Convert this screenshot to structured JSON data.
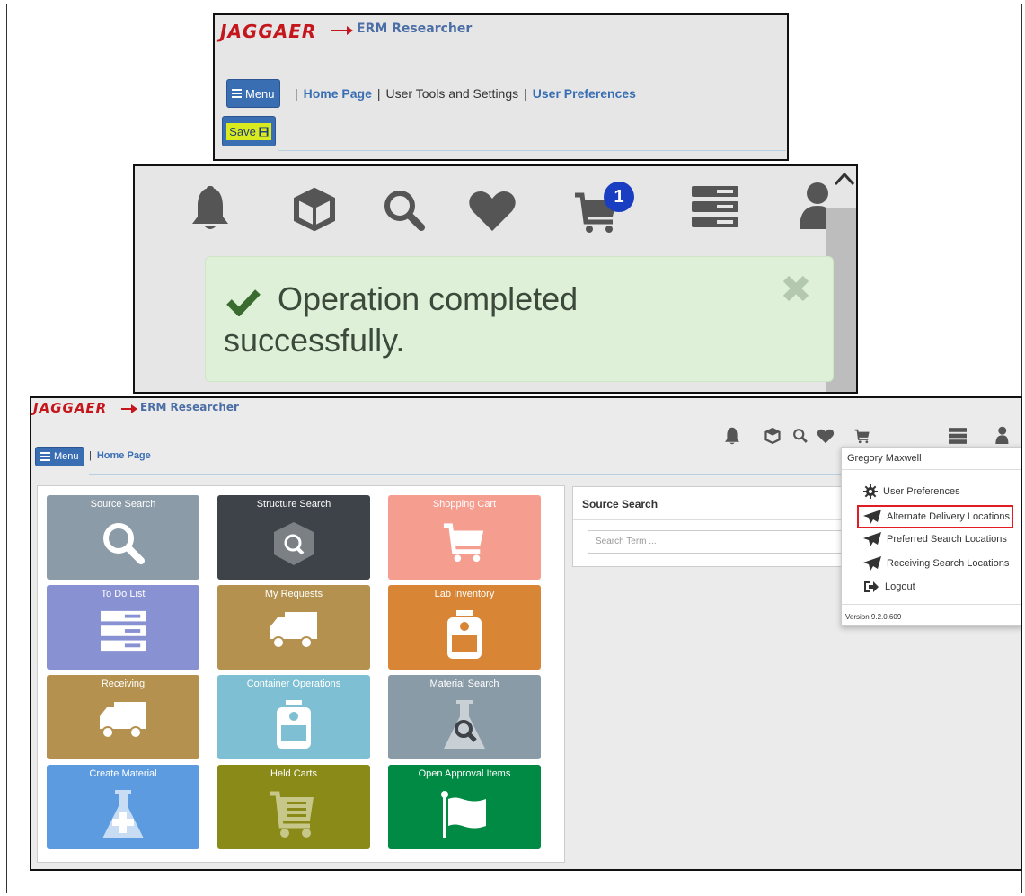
{
  "panel1": {
    "logo": "JAGGAER",
    "app_name": "ERM Researcher",
    "menu_label": "Menu",
    "breadcrumb": [
      "Home Page",
      "User Tools and Settings",
      "User Preferences"
    ],
    "save_label": "Save"
  },
  "panel2": {
    "cart_count": "1",
    "message_line1": "Operation completed",
    "message_line2": "successfully."
  },
  "panel3": {
    "logo": "JAGGAER",
    "app_name": "ERM Researcher",
    "menu_label": "Menu",
    "breadcrumb": "Home Page",
    "tiles": [
      {
        "label": "Source Search",
        "color": "#8c9ba8",
        "icon": "search-icon"
      },
      {
        "label": "Structure Search",
        "color": "#3d4349",
        "icon": "cube-search-icon"
      },
      {
        "label": "Shopping Cart",
        "color": "#f59d8f",
        "icon": "cart-icon"
      },
      {
        "label": "To Do List",
        "color": "#8891d2",
        "icon": "server-icon"
      },
      {
        "label": "My Requests",
        "color": "#b4914f",
        "icon": "truck-icon"
      },
      {
        "label": "Lab Inventory",
        "color": "#d88535",
        "icon": "bottle-icon"
      },
      {
        "label": "Receiving",
        "color": "#b4914f",
        "icon": "truck-icon"
      },
      {
        "label": "Container Operations",
        "color": "#7ebfd3",
        "icon": "bottle-icon"
      },
      {
        "label": "Material Search",
        "color": "#8a9ba8",
        "icon": "flask-search-icon"
      },
      {
        "label": "Create Material",
        "color": "#5c9be0",
        "icon": "flask-plus-icon"
      },
      {
        "label": "Held Carts",
        "color": "#898a17",
        "icon": "cart-list-icon"
      },
      {
        "label": "Open Approval Items",
        "color": "#008a44",
        "icon": "flag-icon"
      }
    ],
    "source_search": {
      "title": "Source Search",
      "placeholder": "Search Term ..."
    },
    "user_menu": {
      "user_name": "Gregory Maxwell",
      "items": [
        {
          "label": "User Preferences",
          "icon": "gear-icon"
        },
        {
          "label": "Alternate Delivery Locations",
          "icon": "paper-plane-icon"
        },
        {
          "label": "Preferred Search Locations",
          "icon": "paper-plane-icon"
        },
        {
          "label": "Receiving Search Locations",
          "icon": "paper-plane-icon"
        },
        {
          "label": "Logout",
          "icon": "logout-icon"
        }
      ],
      "version": "Version 9.2.0.609"
    }
  }
}
